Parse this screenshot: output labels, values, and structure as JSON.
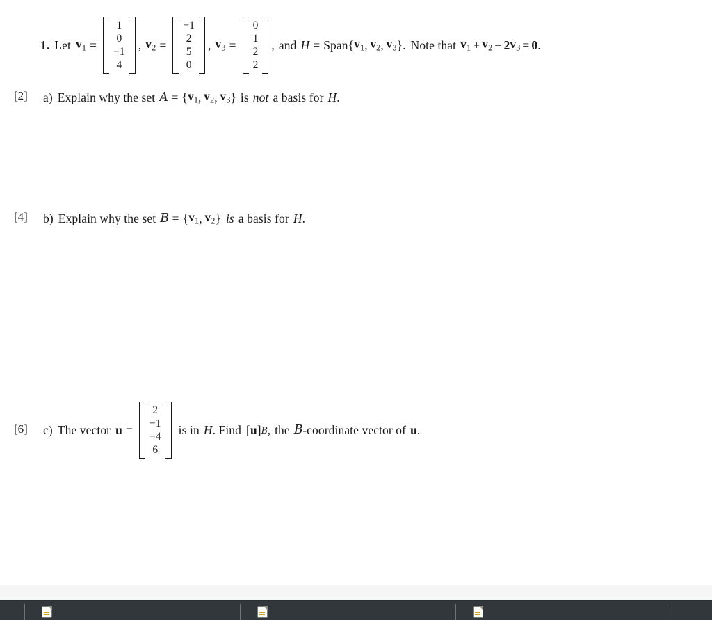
{
  "document": {
    "question": {
      "number": "1.",
      "lead": "Let",
      "v1_label": "v",
      "v1_sub": "1",
      "v1_values": [
        "1",
        "0",
        "−1",
        "4"
      ],
      "v2_label": "v",
      "v2_sub": "2",
      "v2_values": [
        "−1",
        "2",
        "5",
        "0"
      ],
      "v3_label": "v",
      "v3_sub": "3",
      "v3_values": [
        "0",
        "1",
        "2",
        "2"
      ],
      "and_text": "and",
      "H_symbol": "H",
      "span_text": "Span",
      "span_open": "{",
      "span_close": "}.",
      "note_text": "Note that",
      "relation_plus": "+",
      "relation_minus": "−",
      "relation_coeff": "2",
      "relation_equals": "=",
      "relation_zero": "0",
      "relation_period": "."
    },
    "parts": [
      {
        "marks": "[2]",
        "letter": "a)",
        "text_before": "Explain why the set",
        "set_name": "A",
        "equals": "=",
        "set_open": "{",
        "set_members": [
          "v",
          "v",
          "v"
        ],
        "set_member_subs": [
          "1",
          "2",
          "3"
        ],
        "set_close": "}",
        "text_is": "is",
        "emphasis": "not",
        "text_after": "a basis for",
        "space_symbol": "H",
        "period": "."
      },
      {
        "marks": "[4]",
        "letter": "b)",
        "text_before": "Explain why the set",
        "set_name": "B",
        "equals": "=",
        "set_open": "{",
        "set_members": [
          "v",
          "v"
        ],
        "set_member_subs": [
          "1",
          "2"
        ],
        "set_close": "}",
        "emphasis": "is",
        "text_after": "a basis for",
        "space_symbol": "H",
        "period": "."
      },
      {
        "marks": "[6]",
        "letter": "c)",
        "text_before": "The vector",
        "u_label": "u",
        "equals": "=",
        "u_values": [
          "2",
          "−1",
          "−4",
          "6"
        ],
        "text_mid": "is in",
        "space_symbol": "H",
        "find_text": ". Find",
        "coord_open": "[",
        "coord_vec": "u",
        "coord_close": "]",
        "coord_sub": "B",
        "comma": ",",
        "text_the": "the",
        "basis_name": "B",
        "coord_text": "-coordinate vector of",
        "u_label_2": "u",
        "period": "."
      }
    ]
  },
  "taskbar": {
    "items": [
      {
        "icon": "document-icon"
      },
      {
        "icon": "document-icon"
      },
      {
        "icon": "document-icon"
      }
    ]
  }
}
